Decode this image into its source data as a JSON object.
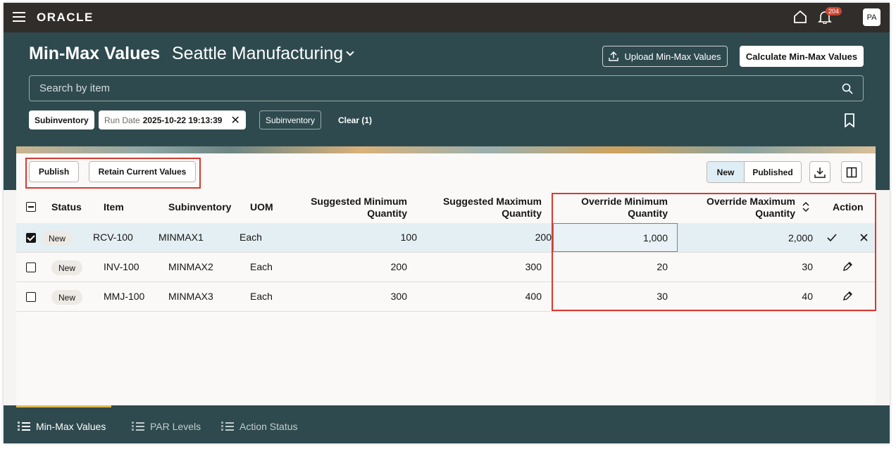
{
  "topbar": {
    "logo": "ORACLE",
    "notification_count": "204",
    "avatar": "PA"
  },
  "header": {
    "title": "Min-Max Values",
    "organization": "Seattle Manufacturing",
    "upload_label": "Upload Min-Max Values",
    "calculate_label": "Calculate Min-Max Values"
  },
  "search": {
    "placeholder": "Search by item"
  },
  "filters": {
    "chip_subinventory": "Subinventory",
    "run_date_label": "Run Date",
    "run_date_value": "2025-10-22 19:13:39",
    "chip_subinventory_2": "Subinventory",
    "clear_label": "Clear (1)"
  },
  "toolbar": {
    "publish": "Publish",
    "retain": "Retain Current Values",
    "seg_new": "New",
    "seg_published": "Published"
  },
  "table": {
    "headers": {
      "status": "Status",
      "item": "Item",
      "subinventory": "Subinventory",
      "uom": "UOM",
      "sugg_min_1": "Suggested Minimum",
      "sugg_min_2": "Quantity",
      "sugg_max_1": "Suggested Maximum",
      "sugg_max_2": "Quantity",
      "ovr_min_1": "Override Minimum",
      "ovr_min_2": "Quantity",
      "ovr_max_1": "Override Maximum",
      "ovr_max_2": "Quantity",
      "action": "Action"
    },
    "rows": [
      {
        "status": "New",
        "item": "RCV-100",
        "subinventory": "MINMAX1",
        "uom": "Each",
        "sugg_min": "100",
        "sugg_max": "200",
        "ovr_min": "1,000",
        "ovr_max": "2,000",
        "selected": true
      },
      {
        "status": "New",
        "item": "INV-100",
        "subinventory": "MINMAX2",
        "uom": "Each",
        "sugg_min": "200",
        "sugg_max": "300",
        "ovr_min": "20",
        "ovr_max": "30",
        "selected": false
      },
      {
        "status": "New",
        "item": "MMJ-100",
        "subinventory": "MINMAX3",
        "uom": "Each",
        "sugg_min": "300",
        "sugg_max": "400",
        "ovr_min": "30",
        "ovr_max": "40",
        "selected": false
      }
    ]
  },
  "bottom_nav": {
    "items": [
      {
        "label": "Min-Max Values",
        "active": true
      },
      {
        "label": "PAR Levels",
        "active": false
      },
      {
        "label": "Action Status",
        "active": false
      }
    ]
  },
  "colors": {
    "header_band": "#2e4a4f",
    "topbar": "#312d2a",
    "highlight": "#d63b2f",
    "badge": "#c74634"
  }
}
